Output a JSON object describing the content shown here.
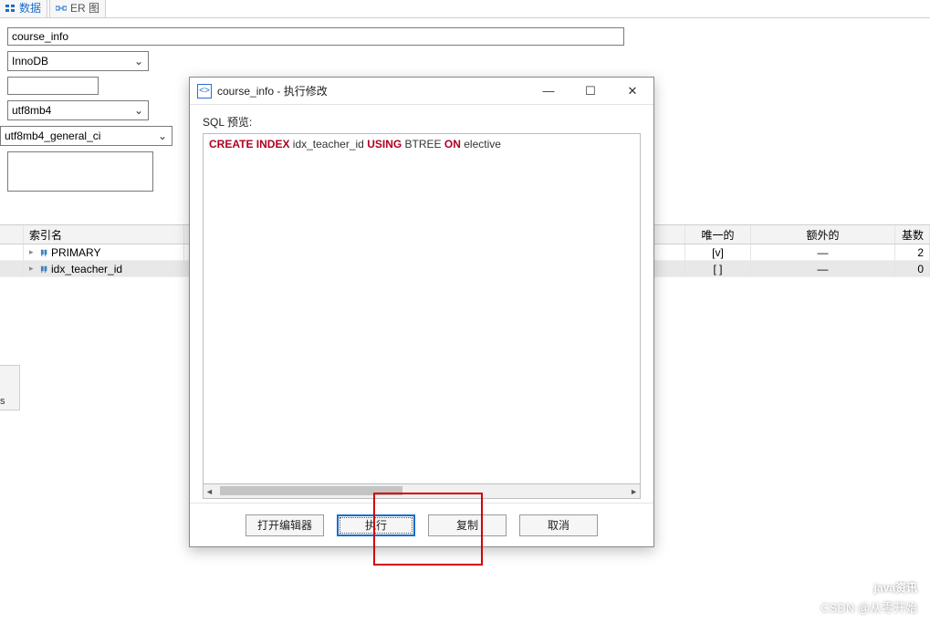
{
  "tabs": {
    "data": "数据",
    "er": "ER 图"
  },
  "form": {
    "table_name": "course_info",
    "engine": "InnoDB",
    "blank": "",
    "charset": "utf8mb4",
    "collation": "utf8mb4_general_ci"
  },
  "index_table": {
    "headers": {
      "name": "索引名",
      "unique": "唯一的",
      "extra": "额外的",
      "cardinality": "基数"
    },
    "rows": [
      {
        "name": "PRIMARY",
        "unique": "[v]",
        "extra": "—",
        "card": "2"
      },
      {
        "name": "idx_teacher_id",
        "unique": "[ ]",
        "extra": "—",
        "card": "0"
      }
    ]
  },
  "side_label": "ics",
  "dialog": {
    "title": "course_info - 执行修改",
    "sql_label": "SQL 预览:",
    "sql_parts": {
      "kw1": "CREATE INDEX",
      "ident1": " idx_teacher_id ",
      "kw2": "USING",
      "ident2": " BTREE ",
      "kw3": "ON",
      "ident3": " elective"
    },
    "buttons": {
      "open_editor": "打开编辑器",
      "execute": "执行",
      "copy": "复制",
      "cancel": "取消"
    },
    "win": {
      "min": "—",
      "max": "☐",
      "close": "✕"
    }
  },
  "watermark": {
    "line1": "java资讯",
    "line2": "CSDN @从零开始"
  }
}
